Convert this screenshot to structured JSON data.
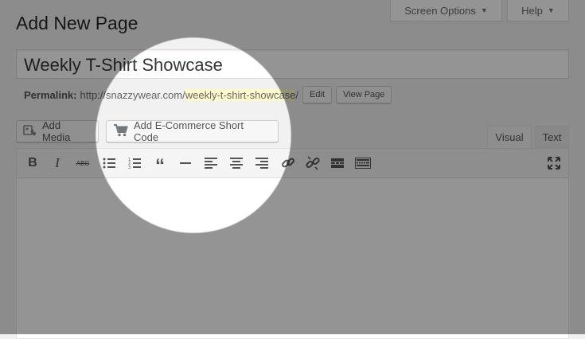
{
  "header": {
    "screen_options_label": "Screen Options",
    "help_label": "Help"
  },
  "page": {
    "title": "Add New Page",
    "post_title_value": "Weekly T-Shirt Showcase"
  },
  "permalink": {
    "label": "Permalink:",
    "base": "http://snazzywear.com/",
    "slug": "weekly-t-shirt-showcase",
    "trailing": "/",
    "edit_label": "Edit",
    "view_label": "View Page"
  },
  "media_buttons": {
    "add_media_label": "Add Media",
    "ecommerce_label": "Add E-Commerce Short Code"
  },
  "editor": {
    "tabs": {
      "visual": "Visual",
      "text": "Text"
    },
    "toolbar": [
      "bold-icon",
      "italic-icon",
      "strikethrough-icon",
      "bullet-list-icon",
      "numbered-list-icon",
      "blockquote-icon",
      "horizontal-rule-icon",
      "align-left-icon",
      "align-center-icon",
      "align-right-icon",
      "insert-link-icon",
      "remove-link-icon",
      "read-more-icon",
      "toolbar-toggle-icon",
      "fullscreen-icon"
    ],
    "toolbar_glyphs": {
      "bold": "B",
      "italic": "I",
      "strikethrough": "ABC"
    }
  },
  "colors": {
    "accent_highlight": "#fffbcc",
    "overlay": "rgba(0,0,0,0.42)"
  }
}
